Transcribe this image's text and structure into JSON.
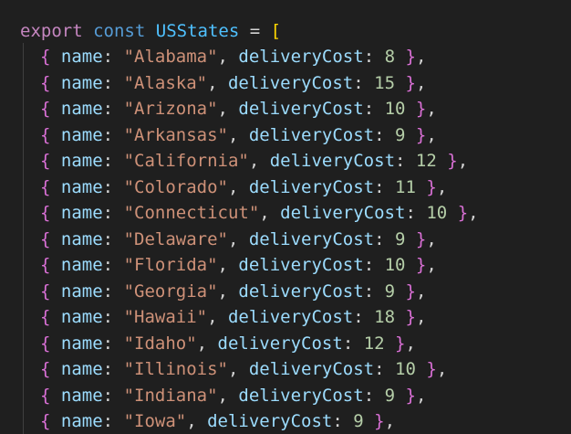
{
  "code": {
    "export_kw": "export",
    "const_kw": "const",
    "var_name": "USStates",
    "equals": "=",
    "open_bracket": "[",
    "prop_name": "name",
    "prop_cost": "deliveryCost",
    "open_brace": "{",
    "close_brace": "}",
    "rows": [
      {
        "name": "\"Alabama\"",
        "cost": "8"
      },
      {
        "name": "\"Alaska\"",
        "cost": "15"
      },
      {
        "name": "\"Arizona\"",
        "cost": "10"
      },
      {
        "name": "\"Arkansas\"",
        "cost": "9"
      },
      {
        "name": "\"California\"",
        "cost": "12"
      },
      {
        "name": "\"Colorado\"",
        "cost": "11"
      },
      {
        "name": "\"Connecticut\"",
        "cost": "10"
      },
      {
        "name": "\"Delaware\"",
        "cost": "9"
      },
      {
        "name": "\"Florida\"",
        "cost": "10"
      },
      {
        "name": "\"Georgia\"",
        "cost": "9"
      },
      {
        "name": "\"Hawaii\"",
        "cost": "18"
      },
      {
        "name": "\"Idaho\"",
        "cost": "12"
      },
      {
        "name": "\"Illinois\"",
        "cost": "10"
      },
      {
        "name": "\"Indiana\"",
        "cost": "9"
      },
      {
        "name": "\"Iowa\"",
        "cost": "9"
      }
    ]
  },
  "colors": {
    "background": "#1f1f1f",
    "keyword": "#569cd6",
    "identifier": "#4fc1ff",
    "property": "#9cdcfe",
    "string": "#ce9178",
    "number": "#b5cea8",
    "bracket_level1": "#ffd700",
    "bracket_level2": "#da70d6"
  }
}
